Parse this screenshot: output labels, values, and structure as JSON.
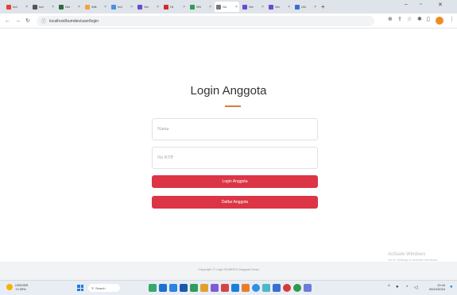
{
  "browser": {
    "tabs": [
      {
        "label": "Ind",
        "color": "#e34133",
        "active": false
      },
      {
        "label": "Ind",
        "color": "#555555",
        "active": false
      },
      {
        "label": "Der",
        "color": "#2f6d3a",
        "active": false
      },
      {
        "label": "Wik",
        "color": "#f2a33a",
        "active": false
      },
      {
        "label": "Ind",
        "color": "#4a8fe0",
        "active": false
      },
      {
        "label": "Ver",
        "color": "#6a4bd0",
        "active": false
      },
      {
        "label": "Ht",
        "color": "#d22b2b",
        "active": false
      },
      {
        "label": "Wh",
        "color": "#2f9e4f",
        "active": false
      },
      {
        "label": "Gu",
        "color": "#777777",
        "active": true
      },
      {
        "label": "Ver",
        "color": "#6a4bd0",
        "active": false
      },
      {
        "label": "Ver",
        "color": "#6a4bd0",
        "active": false
      },
      {
        "label": "UN",
        "color": "#3a6fd0",
        "active": false
      }
    ],
    "new_tab": "+",
    "url": "localhost/bumdes/user/login"
  },
  "page": {
    "title": "Login Anggota",
    "nama_placeholder": "Nama",
    "ktp_placeholder": "No KTP",
    "login_button": "Login Anggota",
    "daftar_button": "Daftar Anggota",
    "footer": "Copyright © Login BUMDES Anggota Desa"
  },
  "watermark": {
    "line1": "Activate Windows",
    "line2": "Go to Settings to activate Windows."
  },
  "taskbar": {
    "weather_line1": "USD/IDR",
    "weather_line2": "+0.39%",
    "search": "Search",
    "time": "13:44",
    "date": "05/10/2024"
  }
}
